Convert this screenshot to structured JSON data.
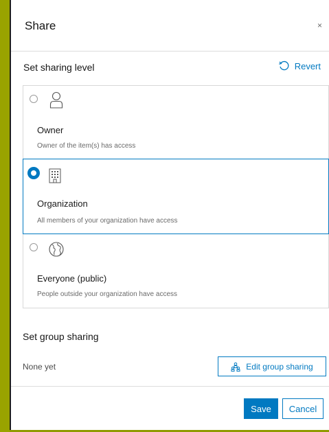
{
  "dialog": {
    "title": "Share",
    "close_glyph": "×"
  },
  "sharing_level": {
    "title": "Set sharing level",
    "revert_label": "Revert",
    "options": [
      {
        "label": "Owner",
        "description": "Owner of the item(s) has access",
        "icon": "user-icon",
        "selected": false
      },
      {
        "label": "Organization",
        "description": "All members of your organization have access",
        "icon": "building-icon",
        "selected": true
      },
      {
        "label": "Everyone (public)",
        "description": "People outside your organization have access",
        "icon": "globe-icon",
        "selected": false
      }
    ]
  },
  "group_sharing": {
    "title": "Set group sharing",
    "status": "None yet",
    "edit_label": "Edit group sharing"
  },
  "footer": {
    "save_label": "Save",
    "cancel_label": "Cancel"
  },
  "colors": {
    "accent": "#0079c1",
    "backdrop": "#8f9a00"
  }
}
